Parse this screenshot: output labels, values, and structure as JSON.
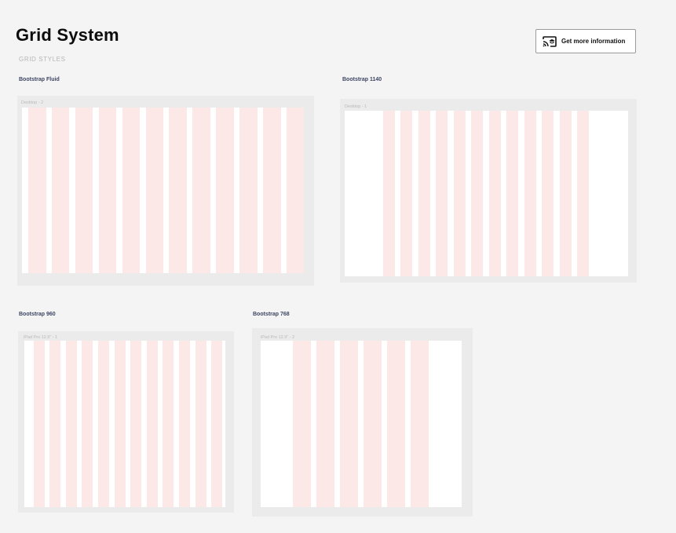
{
  "header": {
    "title": "Grid System",
    "subtitle": "GRID STYLES",
    "info_button_label": "Get more information",
    "info_button_icon": "cast-school-icon"
  },
  "colors": {
    "page_background": "#f4f4f4",
    "frame_background": "#ebebeb",
    "canvas": "#ffffff",
    "grid_column": "#fde8e8",
    "section_label": "#3e4663"
  },
  "grids": [
    {
      "id": "fluid",
      "label": "Bootstrap Fluid",
      "frame_name": "Desktop - 2",
      "columns": 12
    },
    {
      "id": "1140",
      "label": "Bootstrap 1140",
      "frame_name": "Desktop - 1",
      "columns": 12
    },
    {
      "id": "960",
      "label": "Bootstrap 960",
      "frame_name": "iPad Pro 12.9\" - 1",
      "columns": 12
    },
    {
      "id": "768",
      "label": "Bootstrap 768",
      "frame_name": "iPad Pro 12.9\" - 2",
      "columns": 6
    }
  ]
}
